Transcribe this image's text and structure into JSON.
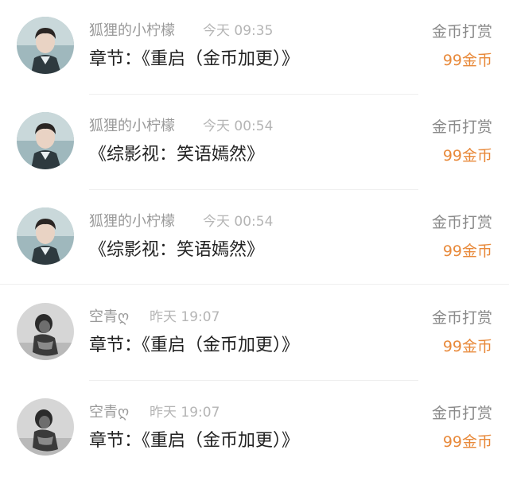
{
  "entries": [
    {
      "user": "狐狸的小柠檬",
      "time": "今天 09:35",
      "content": "章节：《重启（金币加更）》",
      "type": "金币打赏",
      "amount": "99金币",
      "avatar": "male-portrait"
    },
    {
      "user": "狐狸的小柠檬",
      "time": "今天 00:54",
      "content": "《综影视：笑语嫣然》",
      "type": "金币打赏",
      "amount": "99金币",
      "avatar": "male-portrait"
    },
    {
      "user": "狐狸的小柠檬",
      "time": "今天 00:54",
      "content": "《综影视：笑语嫣然》",
      "type": "金币打赏",
      "amount": "99金币",
      "avatar": "male-portrait"
    },
    {
      "user": "空青ღ",
      "time": "昨天 19:07",
      "content": "章节：《重启（金币加更）》",
      "type": "金币打赏",
      "amount": "99金币",
      "avatar": "bw-portrait"
    },
    {
      "user": "空青ღ",
      "time": "昨天 19:07",
      "content": "章节：《重启（金币加更）》",
      "type": "金币打赏",
      "amount": "99金币",
      "avatar": "bw-portrait"
    }
  ],
  "colors": {
    "amount": "#e8893a",
    "name": "#9a9a9a",
    "time": "#b5b5b5"
  }
}
